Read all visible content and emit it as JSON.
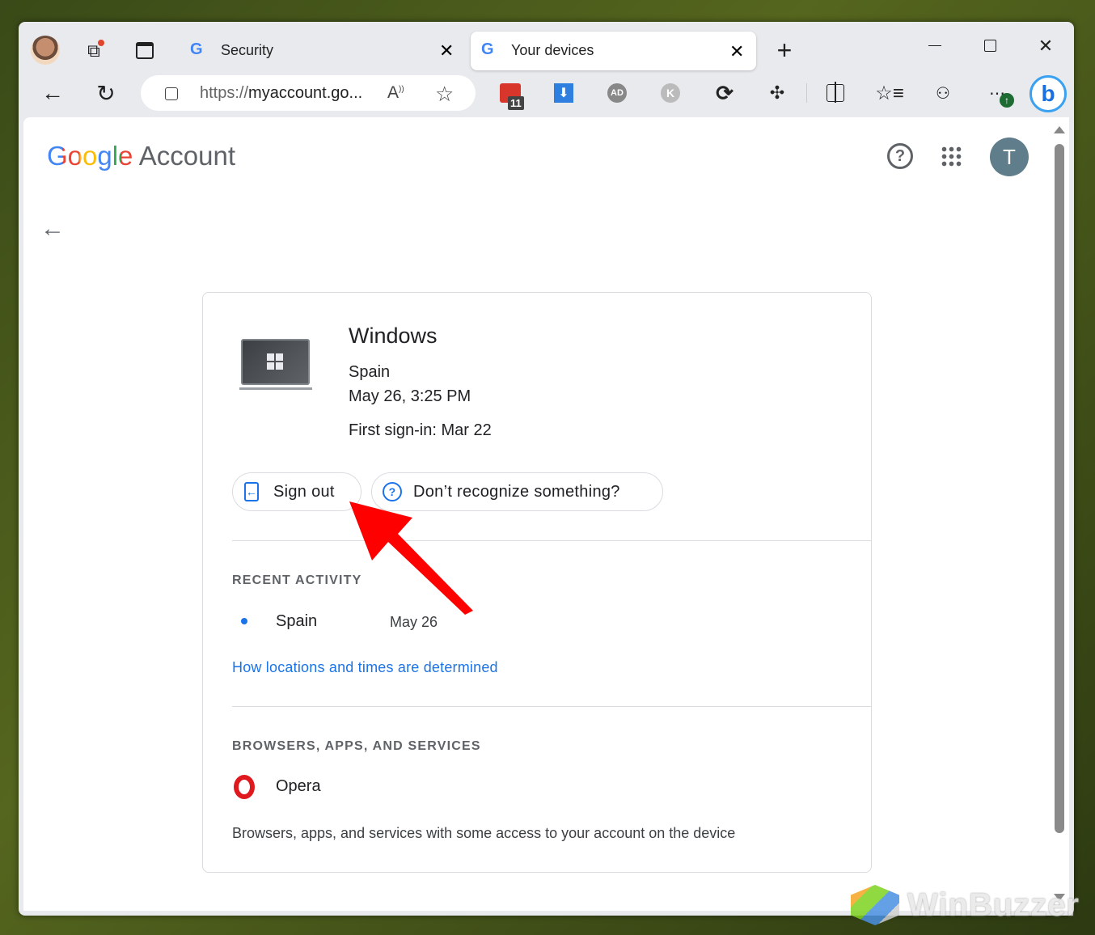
{
  "browser": {
    "tabs": [
      {
        "label": "Security",
        "active": false
      },
      {
        "label": "Your devices",
        "active": true
      }
    ],
    "address": {
      "prefix": "https://",
      "host": "myaccount.go..."
    },
    "extension_badge": "11",
    "icons": [
      "profile-avatar",
      "workspaces-icon",
      "vertical-tabs-icon",
      "new-tab-icon",
      "minimize-icon",
      "maximize-icon",
      "close-icon",
      "back-icon",
      "refresh-icon",
      "lock-icon",
      "read-aloud-icon",
      "favorite-star-icon",
      "split-screen-icon",
      "favorites-icon",
      "collections-icon",
      "more-icon",
      "bing-copilot-icon"
    ]
  },
  "header": {
    "logo_google": "Google",
    "logo_account": "Account",
    "avatar_letter": "T"
  },
  "device": {
    "name": "Windows",
    "location": "Spain",
    "last_active": "May 26, 3:25 PM",
    "first_signin": "First sign-in: Mar 22",
    "sign_out_label": "Sign out",
    "dont_recognize_label": "Don’t recognize something?"
  },
  "recent_activity": {
    "heading": "RECENT ACTIVITY",
    "items": [
      {
        "location": "Spain",
        "date": "May 26"
      }
    ],
    "link": "How locations and times are determined"
  },
  "browsers": {
    "heading": "BROWSERS, APPS, AND SERVICES",
    "items": [
      {
        "name": "Opera"
      }
    ],
    "description": "Browsers, apps, and services with some access to your account on the device"
  },
  "watermark": "WinBuzzer",
  "colors": {
    "accent": "#1a73e8",
    "arrow": "#ff0000"
  }
}
